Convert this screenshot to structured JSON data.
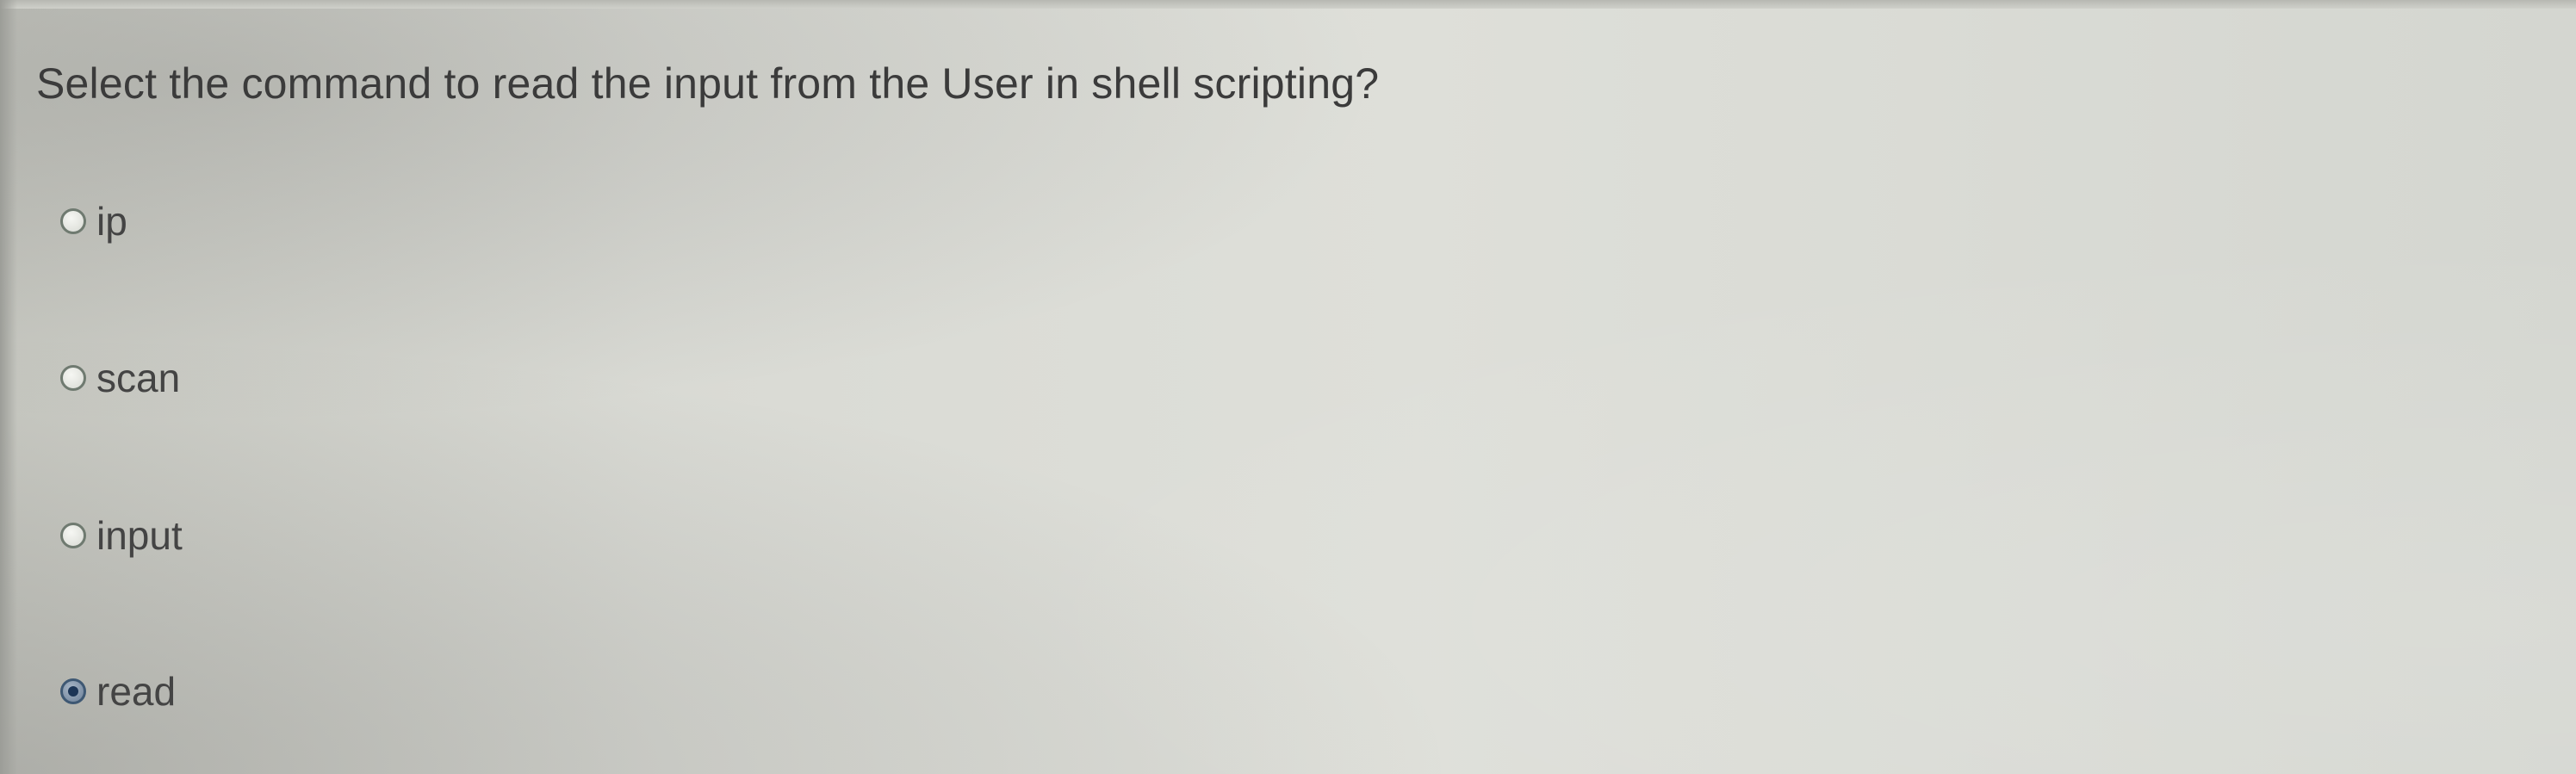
{
  "question": {
    "text": "Select the command to read the input from the User in shell scripting?"
  },
  "options": [
    {
      "label": "ip",
      "selected": false
    },
    {
      "label": "scan",
      "selected": false
    },
    {
      "label": "input",
      "selected": false
    },
    {
      "label": "read",
      "selected": true
    }
  ]
}
